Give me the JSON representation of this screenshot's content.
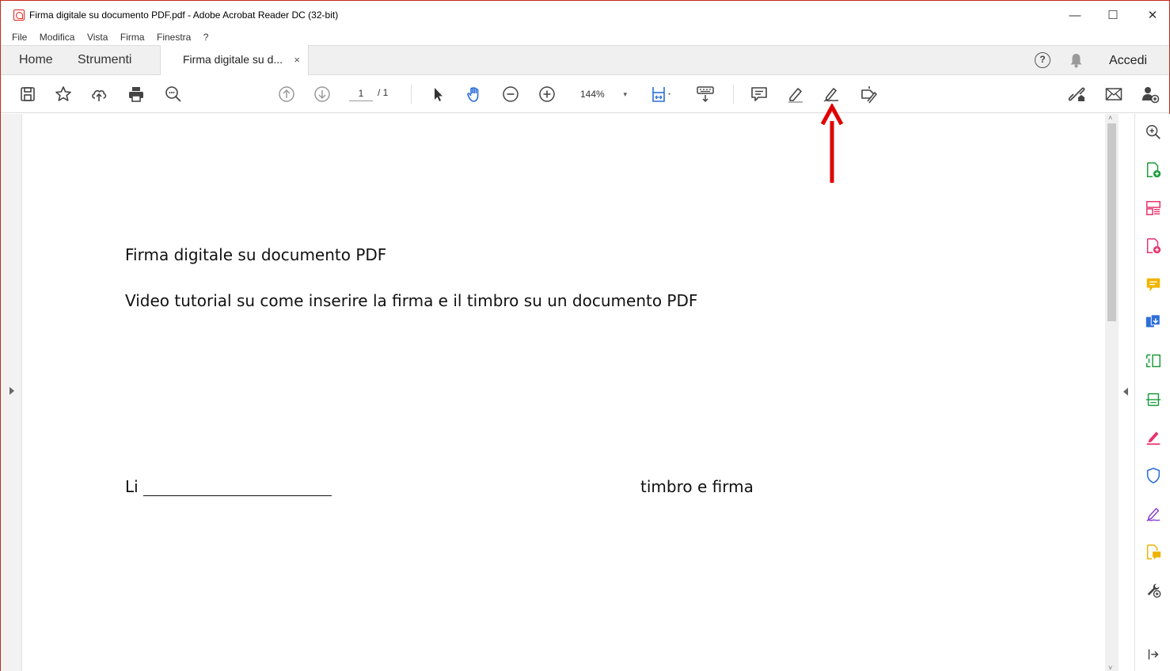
{
  "window": {
    "title": "Firma digitale su documento PDF.pdf - Adobe Acrobat Reader DC (32-bit)",
    "controls": {
      "minimize": "—",
      "maximize": "☐",
      "close": "✕"
    }
  },
  "menu": [
    "File",
    "Modifica",
    "Vista",
    "Firma",
    "Finestra",
    "?"
  ],
  "tabs": {
    "home": "Home",
    "tools": "Strumenti",
    "document": "Firma digitale su d...",
    "close": "×"
  },
  "header_right": {
    "help": "?",
    "signin": "Accedi"
  },
  "toolbar": {
    "page_current": "1",
    "page_total": "/ 1",
    "zoom": "144%",
    "zoom_caret": "▾",
    "icons": [
      "save-icon",
      "bookmark-star-icon",
      "upload-cloud-icon",
      "print-icon",
      "find-zoom-icon",
      "prev-page-icon",
      "next-page-icon",
      "select-arrow-icon",
      "hand-icon",
      "zoom-out-icon",
      "zoom-in-icon",
      "fit-page-icon",
      "keyboard-scroll-icon",
      "comment-icon",
      "highlight-pen-icon",
      "sign-pen-icon",
      "fill-sign-icon",
      "share-link-icon",
      "email-icon",
      "add-user-icon"
    ]
  },
  "document": {
    "line1": "Firma digitale su documento PDF",
    "line2": "Video tutorial su come inserire la firma e il timbro su un documento PDF",
    "li_label": "Li",
    "stamp_label": "timbro e firma"
  },
  "scroll": {
    "up": "˄",
    "down": "˅"
  },
  "colors": {
    "accent_red": "#e0221a",
    "annotation_arrow": "#e00000",
    "tool_green": "#1a9c3a",
    "tool_pink": "#e8336b",
    "tool_yellow": "#f0b400",
    "tool_blue": "#2d6fd8",
    "tool_purple": "#8a3fd1"
  }
}
